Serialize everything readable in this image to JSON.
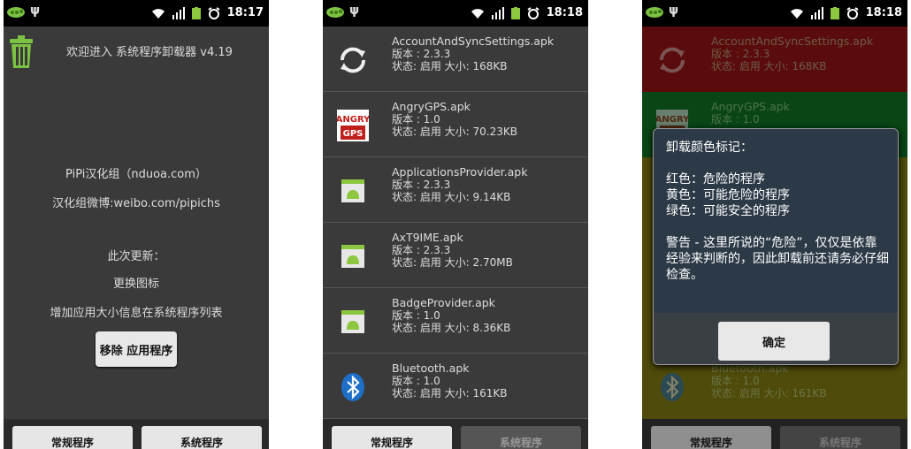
{
  "status_bars": [
    {
      "time": "18:17"
    },
    {
      "time": "18:18"
    },
    {
      "time": "18:18"
    }
  ],
  "screen1": {
    "welcome": "欢迎进入 系统程序卸载器 v4.19",
    "lines": [
      "PiPi汉化组（nduoa.com）",
      "汉化组微博:weibo.com/pipichs",
      "此次更新：",
      "更换图标",
      "增加应用大小信息在系统程序列表"
    ],
    "remove_button": "移除 应用程序"
  },
  "tabs": {
    "normal": "常规程序",
    "system": "系统程序"
  },
  "apps": [
    {
      "name": "AccountAndSyncSettings.apk",
      "version": "版本 : 2.3.3",
      "status": "状态: 启用   大小: 168KB",
      "icon": "sync-icon",
      "color": "#8a1212"
    },
    {
      "name": "AngryGPS.apk",
      "version": "版本 : 1.0",
      "status": "状态: 启用   大小: 70.23KB",
      "icon": "angry-gps-icon",
      "color": "#0f6b21"
    },
    {
      "name": "ApplicationsProvider.apk",
      "version": "版本 : 2.3.3",
      "status": "状态: 启用   大小: 9.14KB",
      "icon": "android-icon",
      "color": "#7a7410"
    },
    {
      "name": "AxT9IME.apk",
      "version": "版本 : 2.3.3",
      "status": "状态: 启用   大小: 2.70MB",
      "icon": "android-icon",
      "color": "#7a7410"
    },
    {
      "name": "BadgeProvider.apk",
      "version": "版本 : 1.0",
      "status": "状态: 启用   大小: 8.36KB",
      "icon": "android-icon",
      "color": "#7a7410"
    },
    {
      "name": "Bluetooth.apk",
      "version": "版本 : 1.0",
      "status": "状态: 启用   大小: 161KB",
      "icon": "bluetooth-icon",
      "color": "#7a7410"
    }
  ],
  "dialog": {
    "title": "卸载颜色标记：",
    "red": "红色：危险的程序",
    "yellow": "黄色：可能危险的程序",
    "green": "绿色：可能安全的程序",
    "warning": "警告 - 这里所说的“危险”，仅仅是依靠经验来判断的，因此卸载前还请务必仔细检查。",
    "ok": "确定"
  }
}
